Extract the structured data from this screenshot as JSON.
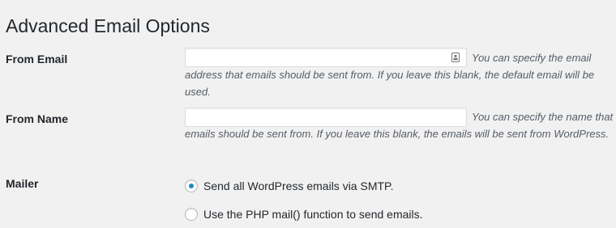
{
  "page": {
    "title": "Advanced Email Options"
  },
  "from_email": {
    "label": "From Email",
    "value": "",
    "placeholder": "",
    "description_line1": "You can specify the email",
    "description_line2": "address that emails should be sent from. If you leave this blank, the default email will be used.",
    "icon": "contact-card-icon"
  },
  "from_name": {
    "label": "From Name",
    "value": "",
    "placeholder": "",
    "description_line1": "You can specify the name that",
    "description_line2": "emails should be sent from. If you leave this blank, the emails will be sent from WordPress."
  },
  "mailer": {
    "label": "Mailer",
    "options": [
      {
        "label": "Send all WordPress emails via SMTP.",
        "checked": true
      },
      {
        "label": "Use the PHP mail() function to send emails.",
        "checked": false
      }
    ]
  },
  "colors": {
    "background": "#f1f1f1",
    "radio_checked": "#1e8cbe",
    "description_text": "#555d66"
  }
}
